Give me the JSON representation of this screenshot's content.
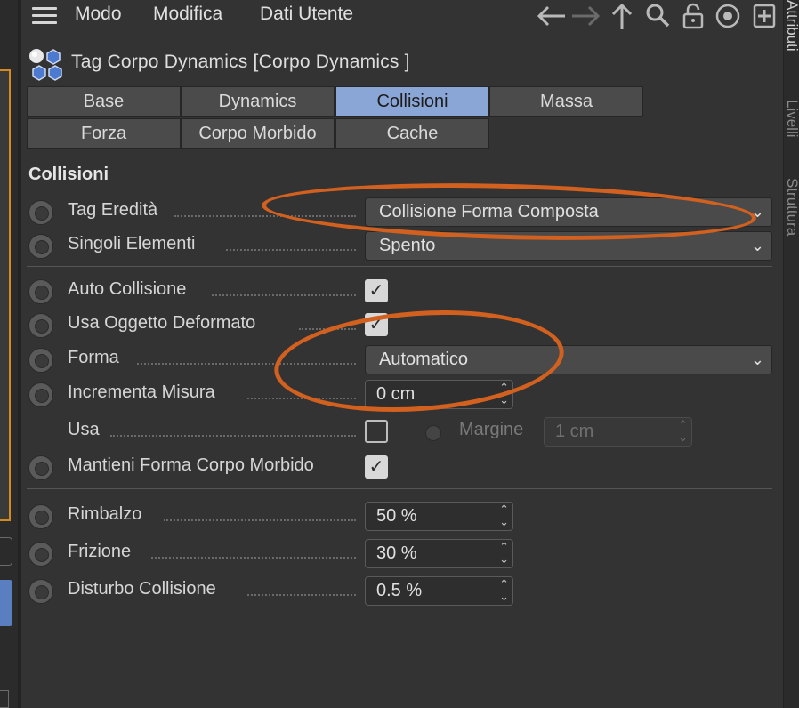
{
  "menu": {
    "items": [
      "Modo",
      "Modifica",
      "Dati Utente"
    ]
  },
  "toolbar": {
    "icons": [
      "arrow-left-icon",
      "arrow-right-icon",
      "arrow-up-icon",
      "search-icon",
      "lock-icon",
      "target-icon",
      "add-panel-icon"
    ]
  },
  "header": {
    "title": "Tag Corpo Dynamics [Corpo Dynamics ]"
  },
  "tabs": [
    {
      "label": "Base",
      "active": false
    },
    {
      "label": "Dynamics",
      "active": false
    },
    {
      "label": "Collisioni",
      "active": true
    },
    {
      "label": "Massa",
      "active": false
    },
    {
      "label": "Forza",
      "active": false
    },
    {
      "label": "Corpo Morbido",
      "active": false
    },
    {
      "label": "Cache",
      "active": false
    }
  ],
  "section": {
    "title": "Collisioni"
  },
  "fields": {
    "tag_ereditata": {
      "label": "Tag Eredità",
      "value": "Collisione Forma Composta"
    },
    "singoli_elementi": {
      "label": "Singoli Elementi",
      "value": "Spento"
    },
    "auto_collisione": {
      "label": "Auto Collisione",
      "checked": true
    },
    "usa_oggetto_deformato": {
      "label": "Usa Oggetto Deformato",
      "checked": true
    },
    "forma": {
      "label": "Forma",
      "value": "Automatico"
    },
    "incrementa_misura": {
      "label": "Incrementa Misura",
      "value": "0 cm"
    },
    "usa": {
      "label": "Usa",
      "checked": false
    },
    "margine": {
      "label": "Margine",
      "value": "1 cm"
    },
    "mantieni_forma": {
      "label": "Mantieni Forma Corpo Morbido",
      "checked": true
    },
    "rimbalzo": {
      "label": "Rimbalzo",
      "value": "50 %"
    },
    "frizione": {
      "label": "Frizione",
      "value": "30 %"
    },
    "disturbo_collisione": {
      "label": "Disturbo Collisione",
      "value": "0.5 %"
    }
  },
  "side_tabs": [
    "Attributi",
    "Livelli",
    "Struttura"
  ],
  "colors": {
    "accent_tab": "#8aa6d6",
    "annotation": "#d2601f",
    "panel_bg": "#333333"
  }
}
